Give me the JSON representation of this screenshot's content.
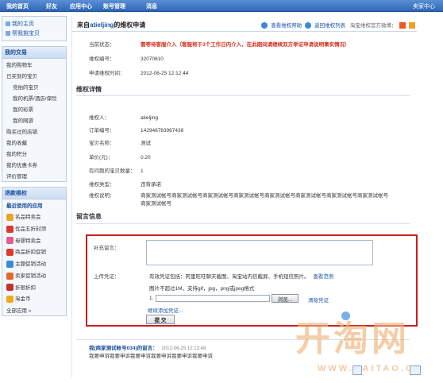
{
  "nav": {
    "tabs": [
      "我的首页",
      "好友",
      "应用中心",
      "账号管理",
      "消息"
    ],
    "right": "卖家中心"
  },
  "sidebar": {
    "top_links": [
      "我的主页",
      "帮我挑宝贝"
    ],
    "trade_title": "我的交易",
    "trade_items": [
      {
        "label": "我的购物车",
        "sub": false
      },
      {
        "label": "已买到的宝贝",
        "sub": false
      },
      {
        "label": "竞拍的宝贝",
        "sub": true
      },
      {
        "label": "我的机票/酒店/保险",
        "sub": true
      },
      {
        "label": "我的彩票",
        "sub": true
      },
      {
        "label": "我的网游",
        "sub": true
      },
      {
        "label": "购买过的店铺",
        "sub": false
      },
      {
        "label": "我的收藏",
        "sub": false
      },
      {
        "label": "我的积分",
        "sub": false
      },
      {
        "label": "我的优惠卡券",
        "sub": false
      },
      {
        "label": "评价管理",
        "sub": false
      }
    ],
    "apps_title": "退款维权",
    "apps_subtitle": "最近使用的应用",
    "apps": [
      {
        "label": "名品特卖会",
        "color": "#e8a42a"
      },
      {
        "label": "优品五折封顶",
        "color": "#d83b2b"
      },
      {
        "label": "母婴特卖会",
        "color": "#e25d8a"
      },
      {
        "label": "商品折扣促销",
        "color": "#d83b2b"
      },
      {
        "label": "主题促销活动",
        "color": "#3a8ad6"
      },
      {
        "label": "卖家促销活动",
        "color": "#e06a2b"
      },
      {
        "label": "折限折扣",
        "color": "#c7302a"
      },
      {
        "label": "淘金币",
        "color": "#f0a820"
      }
    ],
    "all_apps": "全部应用 »"
  },
  "header": {
    "prefix": "来自",
    "user": "atieljing",
    "suffix": "的维权申请",
    "help": "查看维权帮助",
    "back": "返回维权列表",
    "service": "淘宝维权官方微博："
  },
  "status": {
    "label_state": "当前状态：",
    "state_value": "需等待客服介入（客服将于3个工作日内介入，在此期间请继续双方举证申请说明事实情况）",
    "label_no": "维权编号：",
    "no_value": "32070610",
    "label_time": "申请维权时间：",
    "time_value": "2012-06-25 12:12:44"
  },
  "detail": {
    "title": "维权详情",
    "rows": [
      {
        "k": "维权人：",
        "v": "atieljing",
        "link": true
      },
      {
        "k": "订单编号：",
        "v": "142948783967438",
        "link": true
      },
      {
        "k": "宝贝名称：",
        "v": "测试",
        "link": true
      },
      {
        "k": "单价(元)：",
        "v": "0.20",
        "link": false
      },
      {
        "k": "有问题的宝贝数量：",
        "v": "1",
        "link": false
      },
      {
        "k": "维权类型：",
        "v": "违背承诺",
        "link": false
      },
      {
        "k": "维权说明：",
        "v": "商家测试帐号商家测试帐号商家测试帐号商家测试帐号商家测试帐号商家测试帐号商家测试帐号商家测试帐号",
        "link": false
      },
      {
        "k": "",
        "v": "商家测试帐号",
        "link": false
      }
    ]
  },
  "message": {
    "title": "留言信息",
    "label_add": "补充留言：",
    "label_upload": "上传凭证：",
    "upload_hint": "有效凭证包括：阿里旺旺聊天截图、淘宝站内信截屏、手机短信照片。",
    "example_link": "查看范例",
    "size_hint": "图片不超过1M，支持gif，jpg，png或jpeg格式",
    "file_index": "1.",
    "browse": "浏览...",
    "clear": "清除凭证",
    "add_more": "继续添加凭证...",
    "submit": "提 交"
  },
  "msglist": {
    "author": "我(商家测试帐号034)的留言：",
    "time": "2012-06-25 12:13:48",
    "content": "我要申诉我要申诉我要申诉我要申诉我要申诉我要申诉"
  },
  "watermark": {
    "text": "开淘网",
    "url": "WWW.KAITAO.CN"
  }
}
